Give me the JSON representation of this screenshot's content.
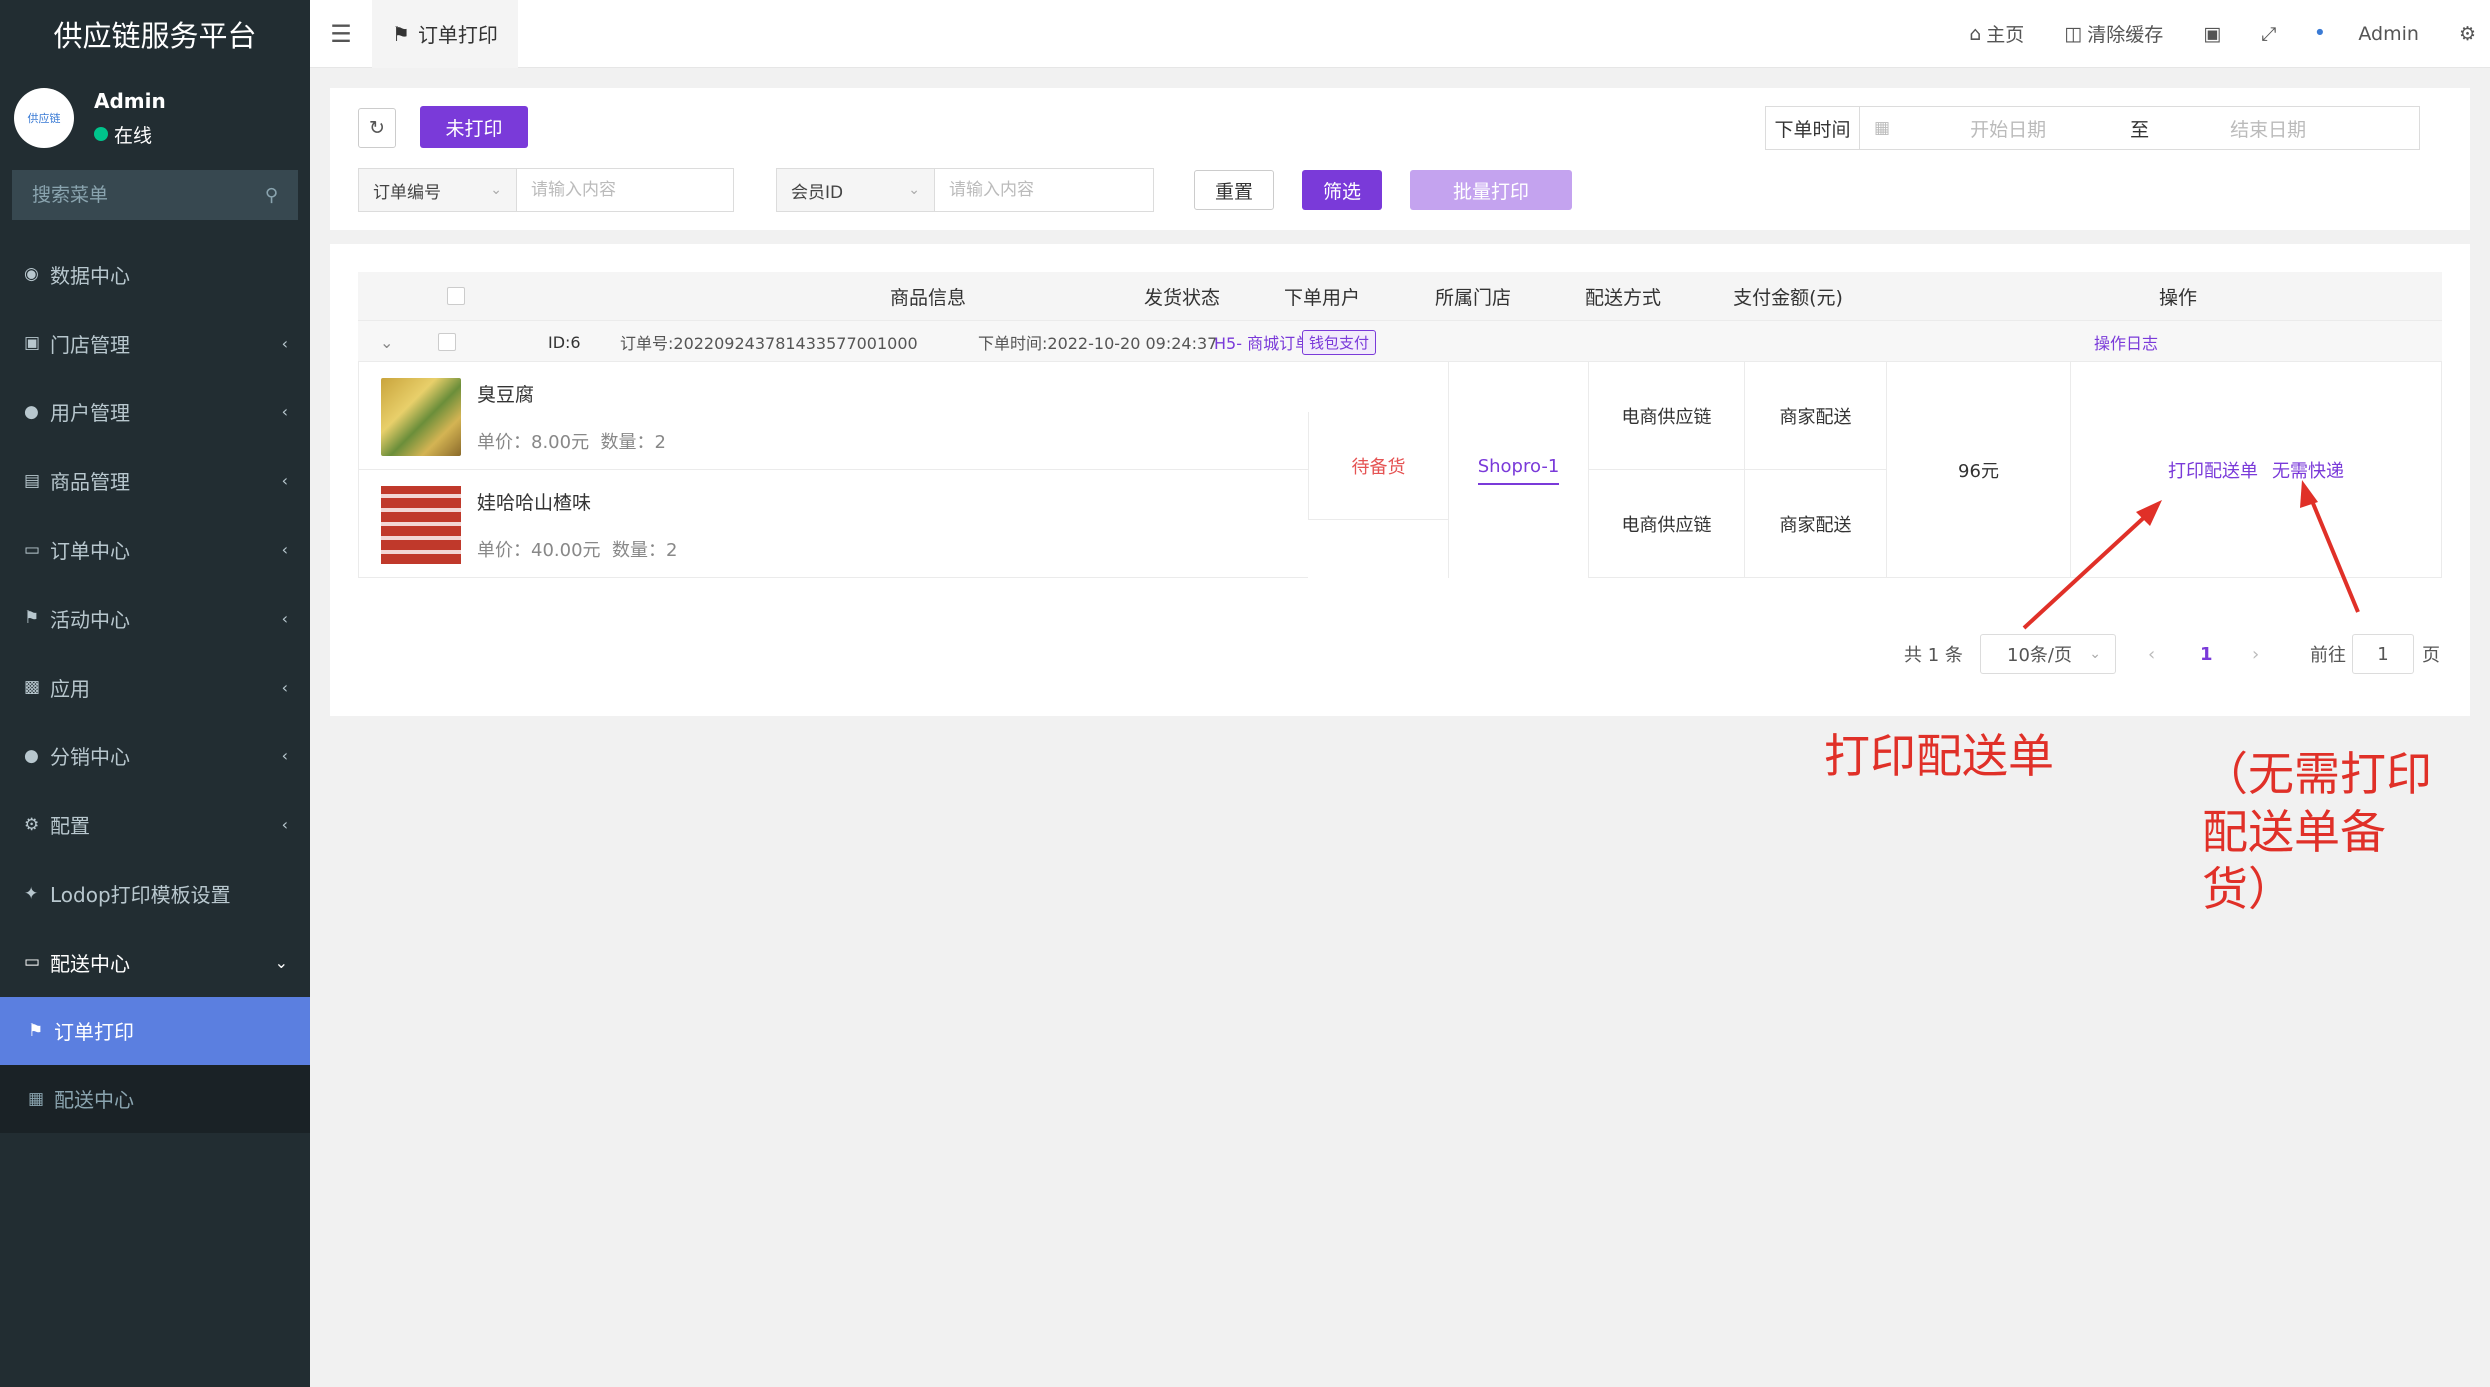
{
  "sidebar": {
    "brand": "供应链服务平台",
    "avatar_text": "供应链",
    "user_name": "Admin",
    "user_status": "在线",
    "search_placeholder": "搜索菜单",
    "items": [
      {
        "label": "数据中心",
        "icon": "dashboard-icon"
      },
      {
        "label": "门店管理",
        "icon": "bank-icon"
      },
      {
        "label": "用户管理",
        "icon": "user-icon"
      },
      {
        "label": "商品管理",
        "icon": "archive-icon"
      },
      {
        "label": "订单中心",
        "icon": "file-icon"
      },
      {
        "label": "活动中心",
        "icon": "flag-icon"
      },
      {
        "label": "应用",
        "icon": "briefcase-icon"
      },
      {
        "label": "分销中心",
        "icon": "users-icon"
      },
      {
        "label": "配置",
        "icon": "gears-icon"
      },
      {
        "label": "Lodop打印模板设置",
        "icon": "wand-icon"
      },
      {
        "label": "配送中心",
        "icon": "file-icon"
      }
    ],
    "sub_items": [
      {
        "label": "订单打印",
        "icon": "flag-icon"
      },
      {
        "label": "配送中心",
        "icon": "calendar-icon"
      }
    ]
  },
  "topbar": {
    "tab_label": "订单打印",
    "home": "主页",
    "clear_cache": "清除缓存",
    "user": "Admin"
  },
  "filters": {
    "unprinted_label": "未打印",
    "date_label": "下单时间",
    "start_date_placeholder": "开始日期",
    "to_label": "至",
    "end_date_placeholder": "结束日期",
    "order_select": "订单编号",
    "order_placeholder": "请输入内容",
    "member_select": "会员ID",
    "member_placeholder": "请输入内容",
    "reset_label": "重置",
    "filter_label": "筛选",
    "batch_print_label": "批量打印"
  },
  "table": {
    "headers": {
      "product_info": "商品信息",
      "ship_status": "发货状态",
      "order_user": "下单用户",
      "store": "所属门店",
      "delivery": "配送方式",
      "amount": "支付金额(元)",
      "actions": "操作"
    },
    "order": {
      "id": "ID:6",
      "order_no": "订单号:202209243781433577001000",
      "order_time": "下单时间:2022-10-20 09:24:37",
      "source": "H5- 商城订单",
      "pay_badge": "钱包支付",
      "log_link": "操作日志",
      "status": "待备货",
      "user": "Shopro-1",
      "amount": "96元",
      "print_action": "打印配送单",
      "no_express_action": "无需快递",
      "products": [
        {
          "name": "臭豆腐",
          "price": "单价：8.00元",
          "qty": "数量：2",
          "store": "电商供应链",
          "delivery": "商家配送"
        },
        {
          "name": "娃哈哈山楂味",
          "price": "单价：40.00元",
          "qty": "数量：2",
          "store": "电商供应链",
          "delivery": "商家配送"
        }
      ]
    }
  },
  "pagination": {
    "total": "共 1 条",
    "page_size": "10条/页",
    "current": "1",
    "goto_label": "前往",
    "goto_value": "1",
    "page_suffix": "页"
  },
  "annotations": {
    "print_note": "打印配送单",
    "no_express_note_1": "（无需打印",
    "no_express_note_2": "配送单备",
    "no_express_note_3": "货）"
  }
}
